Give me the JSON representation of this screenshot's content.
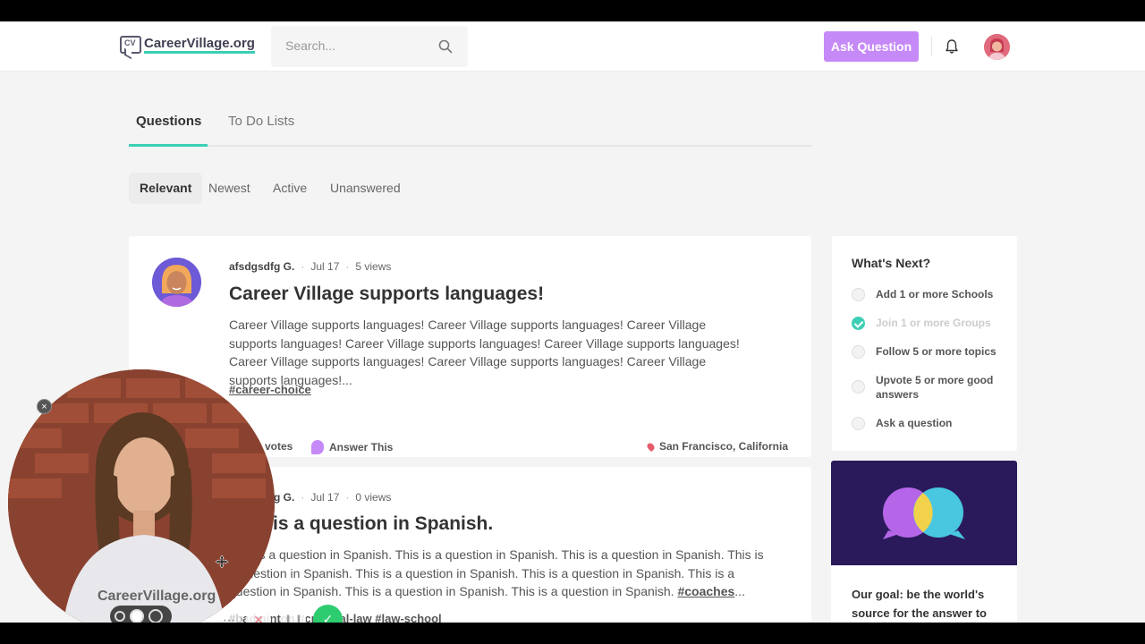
{
  "brand": {
    "logo_text": "CareerVillage.org",
    "accent": "#3ccfb5",
    "purple": "#c58af7"
  },
  "header": {
    "search_placeholder": "Search...",
    "ask_label": "Ask Question"
  },
  "tabs": [
    {
      "label": "Questions",
      "active": true
    },
    {
      "label": "To Do Lists",
      "active": false
    }
  ],
  "filters": [
    {
      "label": "Relevant",
      "active": true
    },
    {
      "label": "Newest",
      "active": false
    },
    {
      "label": "Active",
      "active": false
    },
    {
      "label": "Unanswered",
      "active": false
    }
  ],
  "questions": [
    {
      "author": "afsdgsdfg G.",
      "date": "Jul 17",
      "views": "5 views",
      "title": "Career Village supports languages!",
      "body": "Career Village supports languages! Career Village supports languages! Career Village supports languages! Career Village supports languages! Career Village supports languages! Career Village supports languages! Career Village supports languages! Career Village supports languages!...",
      "tags": "#career-choice",
      "votes": "0 votes",
      "answer_label": "Answer This",
      "location": "San Francisco, California"
    },
    {
      "author": "afsdgsdfg G.",
      "date": "Jul 17",
      "views": "0 views",
      "title": "This is a question in Spanish.",
      "body": "This is a question in Spanish. This is a question in Spanish. This is a question in Spanish. This is a question in Spanish. This is a question in Spanish. This is a question in Spanish. This is a question in Spanish. This is a question in Spanish. This is a question in Spanish.",
      "tag_inline": "#coaches",
      "tags": "#badminton #criminal-law #law-school"
    }
  ],
  "whats_next": {
    "title": "What's Next?",
    "items": [
      {
        "label": "Add 1 or more Schools",
        "done": false
      },
      {
        "label": "Join 1 or more Groups",
        "done": true
      },
      {
        "label": "Follow 5 or more topics",
        "done": false
      },
      {
        "label": "Upvote 5 or more good answers",
        "done": false
      },
      {
        "label": "Ask a question",
        "done": false
      }
    ]
  },
  "goal": {
    "text": "Our goal: be the world's source for the answer to"
  },
  "webcam": {
    "close_glyph": "×",
    "shirt_text": "CareerVillage.org"
  }
}
